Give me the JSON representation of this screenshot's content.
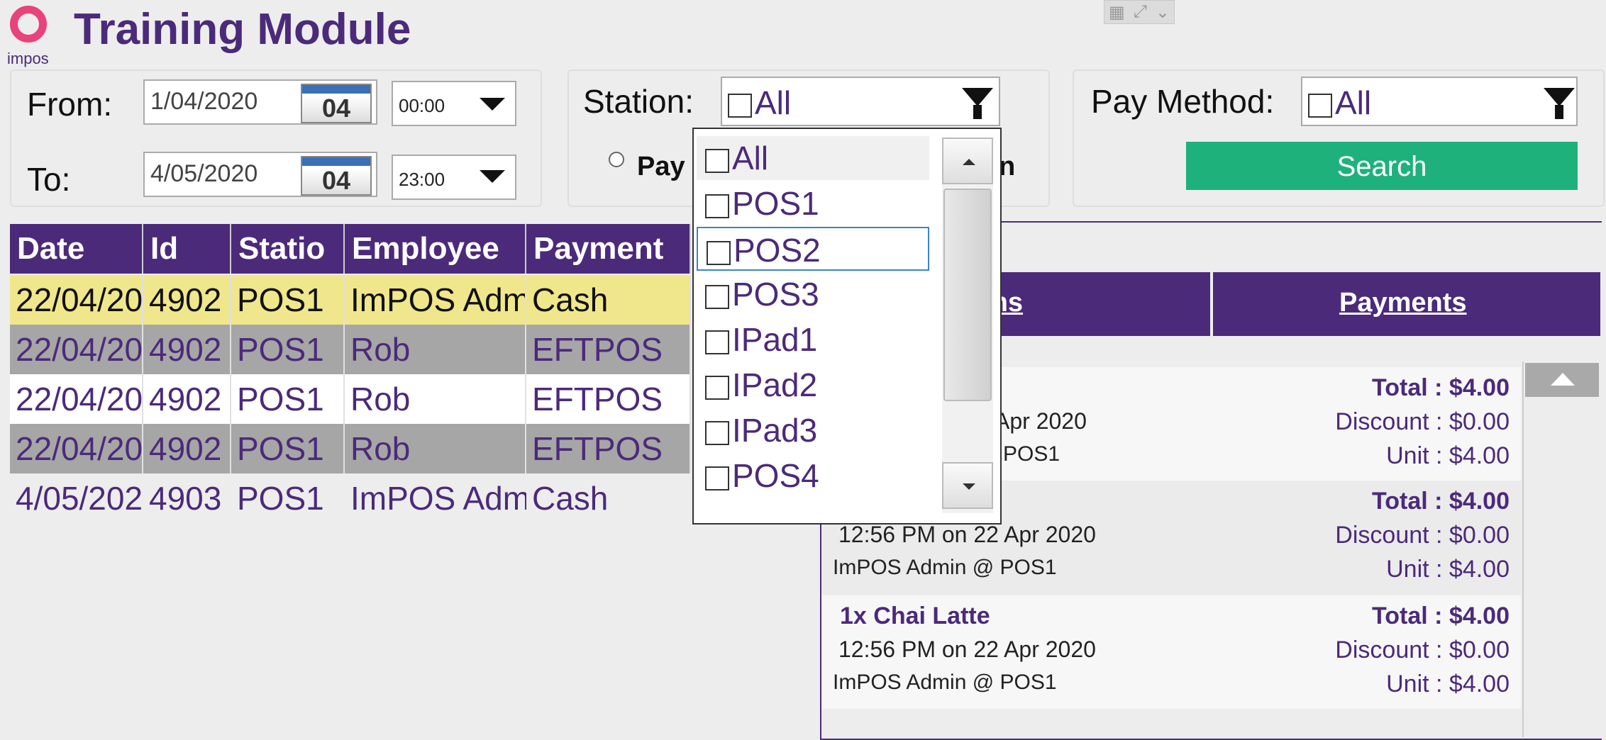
{
  "app": {
    "logo_text": "impos",
    "title": "Training Module"
  },
  "filters": {
    "from_label": "From:",
    "from_date": "1/04/2020",
    "from_day": "04",
    "from_time": "00:00",
    "to_label": "To:",
    "to_date": "4/05/2020",
    "to_day": "04",
    "to_time": "23:00",
    "station_label": "Station:",
    "station_value": "All",
    "pay_method_label": "Pay Method:",
    "pay_method_value": "All",
    "radio_left": "Pay",
    "radio_right_tail": "n",
    "search_label": "Search"
  },
  "station_dropdown": {
    "options": [
      "All",
      "POS1",
      "POS2",
      "POS3",
      "IPad1",
      "IPad2",
      "IPad3",
      "POS4"
    ]
  },
  "table": {
    "headers": [
      "Date",
      "Id",
      "Statio",
      "Employee",
      "Payment"
    ],
    "rows": [
      [
        "22/04/20",
        "4902",
        "POS1",
        "ImPOS Adm",
        "Cash"
      ],
      [
        "22/04/20",
        "4902",
        "POS1",
        "Rob",
        "EFTPOS"
      ],
      [
        "22/04/20",
        "4902",
        "POS1",
        "Rob",
        "EFTPOS"
      ],
      [
        "22/04/20",
        "4902",
        "POS1",
        "Rob",
        "EFTPOS"
      ],
      [
        "4/05/202",
        "4903",
        "POS1",
        "ImPOS Adm",
        "Cash"
      ]
    ]
  },
  "details": {
    "tabs": [
      "ems",
      "Payments"
    ],
    "items": [
      {
        "name": "",
        "when": "Apr 2020",
        "who": "POS1",
        "total": "Total : $4.00",
        "discount": "Discount : $0.00",
        "unit": "Unit : $4.00"
      },
      {
        "name": "",
        "when": "12:56 PM on 22 Apr 2020",
        "who": "ImPOS Admin @ POS1",
        "total": "Total : $4.00",
        "discount": "Discount : $0.00",
        "unit": "Unit : $4.00"
      },
      {
        "name": "1x Chai Latte",
        "when": "12:56 PM on 22 Apr 2020",
        "who": "ImPOS Admin @ POS1",
        "total": "Total : $4.00",
        "discount": "Discount : $0.00",
        "unit": "Unit : $4.00"
      }
    ]
  },
  "colors": {
    "brand": "#4b2a7a",
    "accent": "#e8437b",
    "search": "#1fb17c",
    "selected_row": "#f0e68c",
    "alt_row": "#a6a6a6"
  },
  "icons": [
    "calendar-icon",
    "chevron-down-icon",
    "filter-icon",
    "checkbox-icon",
    "scroll-up-icon",
    "scroll-down-icon"
  ]
}
